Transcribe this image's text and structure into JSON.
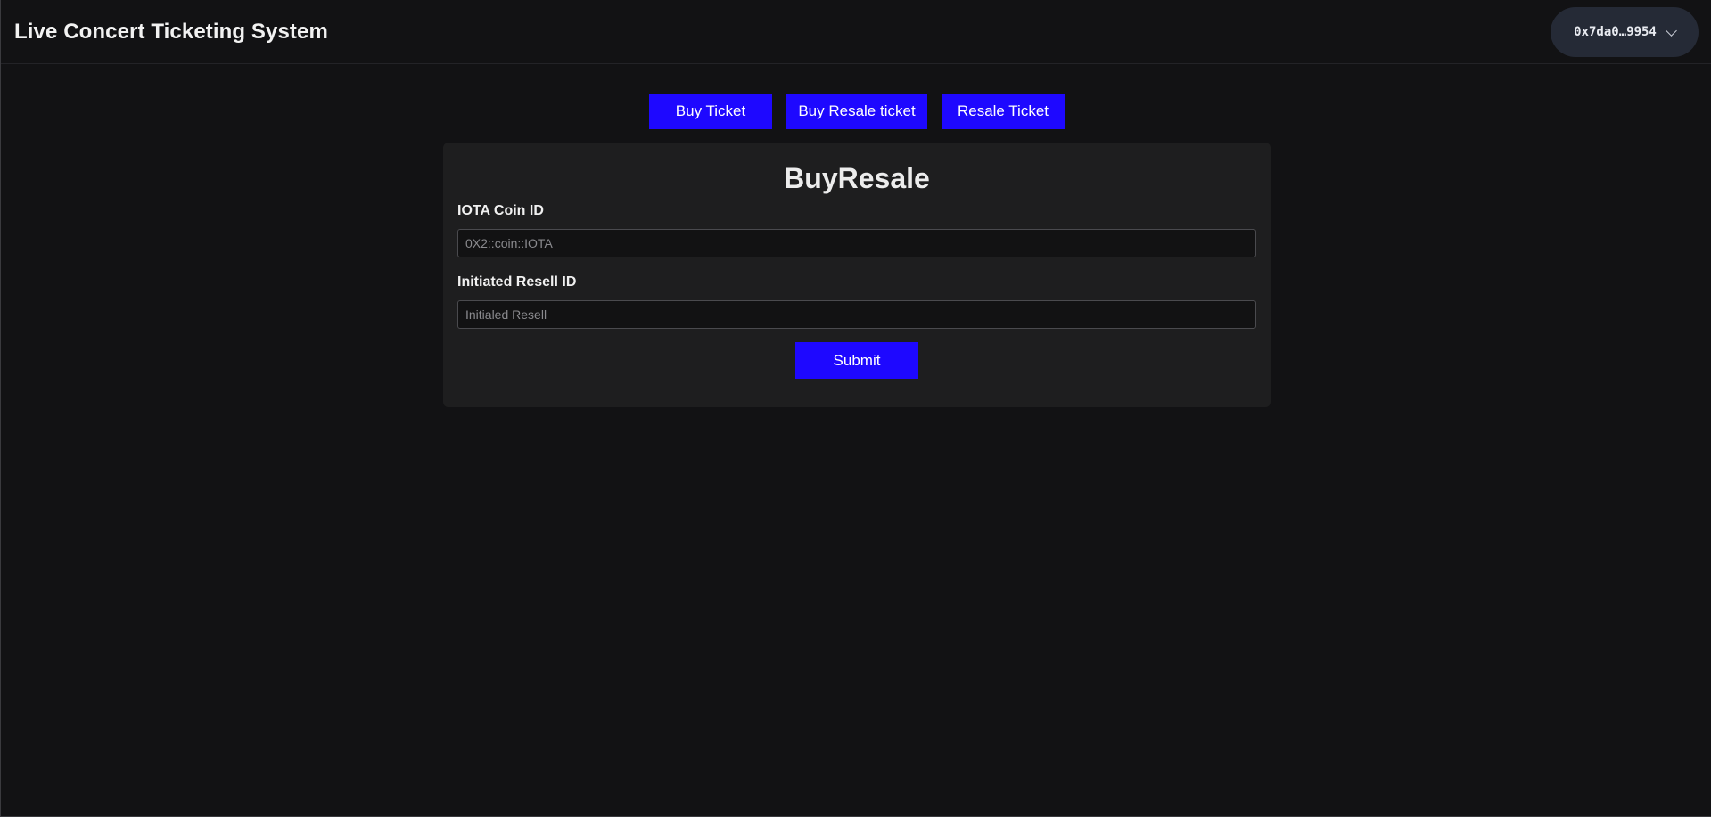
{
  "header": {
    "title": "Live Concert Ticketing System",
    "wallet": {
      "address": "0x7da0…9954",
      "icon": "chevron-down-icon"
    }
  },
  "nav": {
    "buy_ticket": "Buy Ticket",
    "buy_resale_ticket": "Buy Resale ticket",
    "resale_ticket": "Resale Ticket"
  },
  "form": {
    "title": "BuyResale",
    "coin_id": {
      "label": "IOTA Coin ID",
      "placeholder": "0X2::coin::IOTA",
      "value": ""
    },
    "resell_id": {
      "label": "Initiated Resell ID",
      "placeholder": "Initialed Resell",
      "value": ""
    },
    "submit_label": "Submit"
  },
  "colors": {
    "background": "#121214",
    "accent": "#1e08ff",
    "card": "#1e1e1f",
    "wallet_button": "#252a36"
  }
}
